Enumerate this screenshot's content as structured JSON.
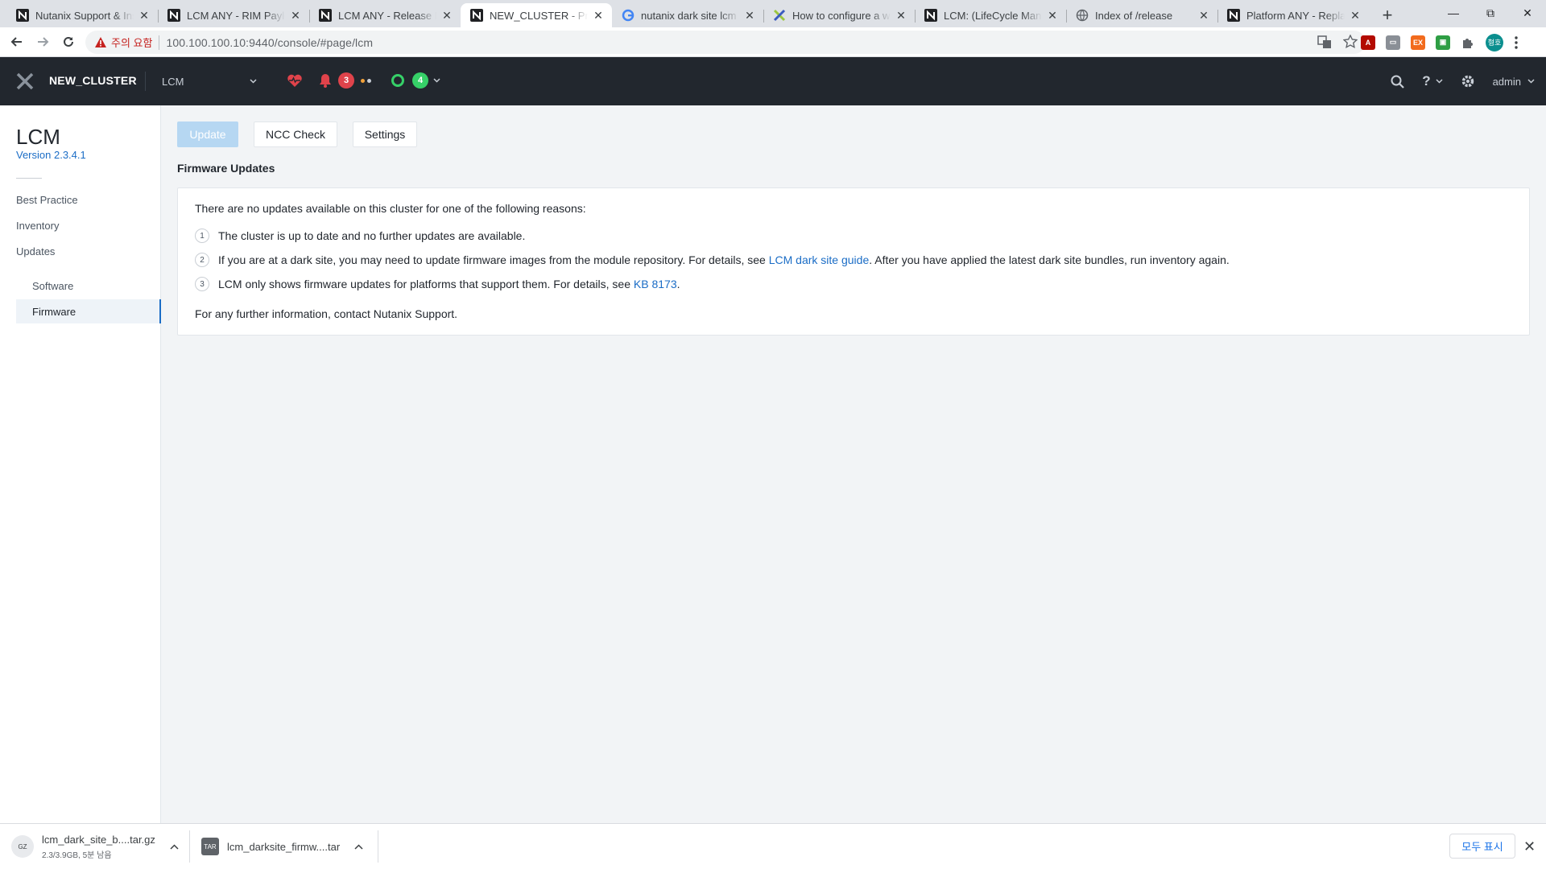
{
  "browser": {
    "tabs": [
      {
        "title": "Nutanix Support & Insights",
        "icon": "nutanix-icon"
      },
      {
        "title": "LCM ANY - RIM Payload",
        "icon": "nutanix-icon"
      },
      {
        "title": "LCM ANY - Release Notes",
        "icon": "nutanix-icon"
      },
      {
        "title": "NEW_CLUSTER - Prism",
        "icon": "nutanix-icon",
        "active": true
      },
      {
        "title": "nutanix dark site lcm li",
        "icon": "google-icon"
      },
      {
        "title": "How to configure a web",
        "icon": "nutanix-x-icon"
      },
      {
        "title": "LCM: (LifeCycle Manager)",
        "icon": "nutanix-icon"
      },
      {
        "title": "Index of /release",
        "icon": "globe-icon"
      },
      {
        "title": "Platform ANY - Replace",
        "icon": "nutanix-icon"
      }
    ],
    "security_warning": "주의 요함",
    "url": "100.100.100.10:9440/console/#page/lcm",
    "profile_initials": "형호"
  },
  "header": {
    "cluster_name": "NEW_CLUSTER",
    "page_select": "LCM",
    "alerts_count": "3",
    "tasks_count": "4",
    "user": "admin",
    "colors": {
      "bg": "#22272e",
      "alert": "#e0434b",
      "task": "#36d068",
      "health": "#e0434b"
    }
  },
  "sidebar": {
    "title": "LCM",
    "version": "Version 2.3.4.1",
    "items": [
      {
        "label": "Best Practice"
      },
      {
        "label": "Inventory"
      },
      {
        "label": "Updates"
      }
    ],
    "sub_items": [
      {
        "label": "Software"
      },
      {
        "label": "Firmware",
        "selected": true
      }
    ]
  },
  "main": {
    "buttons": {
      "update": "Update",
      "ncc": "NCC Check",
      "settings": "Settings"
    },
    "section_title": "Firmware Updates",
    "intro": "There are no updates available on this cluster for one of the following reasons:",
    "reasons": [
      {
        "num": "1",
        "text": "The cluster is up to date and no further updates are available."
      },
      {
        "num": "2",
        "before": "If you are at a dark site, you may need to update firmware images from the module repository. For details, see ",
        "link": "LCM dark site guide",
        "after": ". After you have applied the latest dark site bundles, run inventory again."
      },
      {
        "num": "3",
        "before": "LCM only shows firmware updates for platforms that support them. For details, see ",
        "link": "KB 8173",
        "after": "."
      }
    ],
    "footer": "For any further information, contact Nutanix Support."
  },
  "downloads": [
    {
      "name": "lcm_dark_site_b....tar.gz",
      "status": "2.3/3.9GB, 5분 남음",
      "icon_label": "GZ"
    },
    {
      "name": "lcm_darksite_firmw....tar",
      "icon_label": "TAR"
    }
  ],
  "download_shelf": {
    "show_all": "모두 표시"
  }
}
